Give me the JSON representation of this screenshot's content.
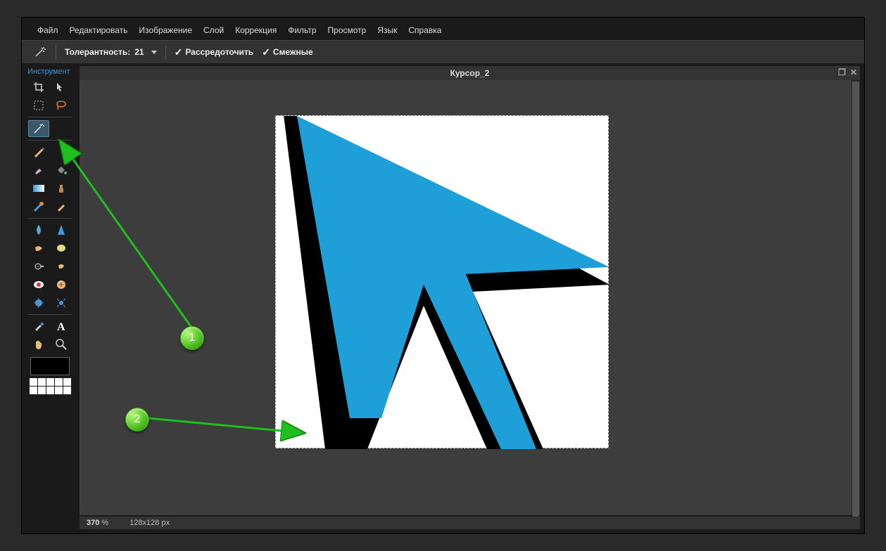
{
  "menu": {
    "items": [
      "Файл",
      "Редактировать",
      "Изображение",
      "Слой",
      "Коррекция",
      "Фильтр",
      "Просмотр",
      "Язык",
      "Справка"
    ]
  },
  "toolbar": {
    "tolerance_label": "Толерантность:",
    "tolerance_value": "21",
    "option1": "Рассредоточить",
    "option2": "Смежные"
  },
  "tools_panel": {
    "title": "Инструмент"
  },
  "document": {
    "title": "Курсор_2"
  },
  "status": {
    "zoom": "370",
    "zoom_unit": "%",
    "dimensions": "128x128 px"
  },
  "annotations": {
    "bubble1": "1",
    "bubble2": "2"
  }
}
